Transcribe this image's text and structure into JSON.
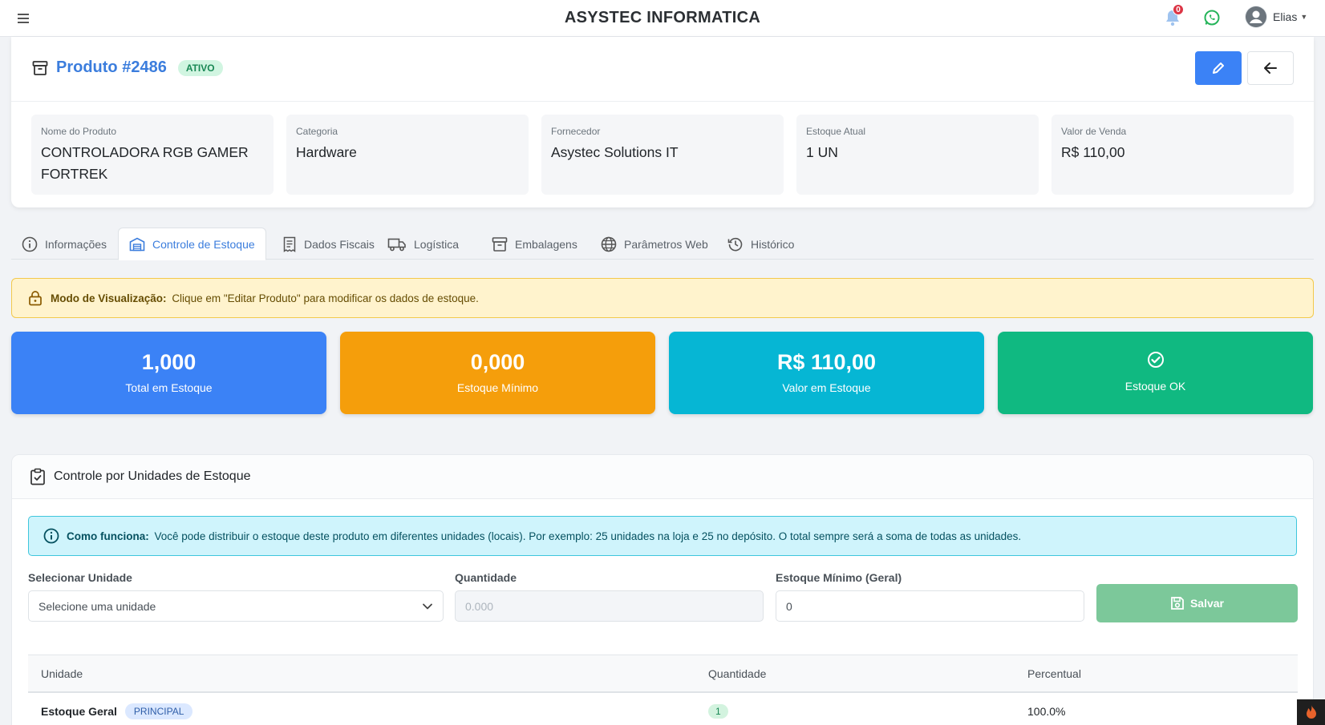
{
  "app": {
    "title": "ASYSTEC INFORMATICA",
    "notifications_count": "0",
    "user_name": "Elias"
  },
  "product": {
    "title": "Produto #2486",
    "status": "ATIVO",
    "fields": [
      {
        "label": "Nome do Produto",
        "value": "CONTROLADORA RGB GAMER FORTREK"
      },
      {
        "label": "Categoria",
        "value": "Hardware"
      },
      {
        "label": "Fornecedor",
        "value": "Asystec Solutions IT"
      },
      {
        "label": "Estoque Atual",
        "value": "1 UN"
      },
      {
        "label": "Valor de Venda",
        "value": "R$ 110,00"
      }
    ]
  },
  "tabs": [
    {
      "label": "Informações",
      "icon": "info-icon"
    },
    {
      "label": "Controle de Estoque",
      "icon": "warehouse-icon",
      "active": true
    },
    {
      "label": "Dados Fiscais",
      "icon": "receipt-icon"
    },
    {
      "label": "Logística",
      "icon": "truck-icon"
    },
    {
      "label": "Embalagens",
      "icon": "box-icon"
    },
    {
      "label": "Parâmetros Web",
      "icon": "globe-icon"
    },
    {
      "label": "Histórico",
      "icon": "history-icon"
    }
  ],
  "view_mode_alert": {
    "title": "Modo de Visualização:",
    "text": "Clique em \"Editar Produto\" para modificar os dados de estoque."
  },
  "stats": [
    {
      "value": "1,000",
      "label": "Total em Estoque",
      "color": "#3b82f6"
    },
    {
      "value": "0,000",
      "label": "Estoque Mínimo",
      "color": "#f59e0b"
    },
    {
      "value": "R$ 110,00",
      "label": "Valor em Estoque",
      "color": "#06b6d4"
    },
    {
      "value": "",
      "label": "Estoque OK",
      "color": "#10b981",
      "icon": "check-circle-icon"
    }
  ],
  "stock_units": {
    "title": "Controle por Unidades de Estoque",
    "how_it_works": {
      "title": "Como funciona:",
      "text": "Você pode distribuir o estoque deste produto em diferentes unidades (locais). Por exemplo: 25 unidades na loja e 25 no depósito. O total sempre será a soma de todas as unidades."
    },
    "form": {
      "unit_label": "Selecionar Unidade",
      "unit_placeholder": "Selecione uma unidade",
      "qty_label": "Quantidade",
      "qty_placeholder": "0.000",
      "min_label": "Estoque Mínimo (Geral)",
      "min_value": "0",
      "save_label": "Salvar"
    },
    "table": {
      "headers": [
        "Unidade",
        "Quantidade",
        "Percentual"
      ],
      "rows": [
        {
          "unit": "Estoque Geral",
          "badge": "PRINCIPAL",
          "qty": "1",
          "percent": "100.0%"
        }
      ]
    }
  }
}
